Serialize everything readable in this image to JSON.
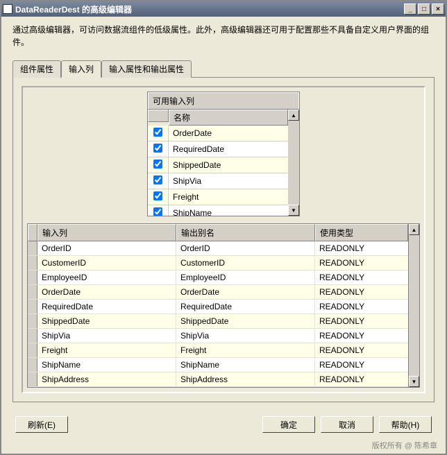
{
  "window": {
    "title": "DataReaderDest 的高级编辑器"
  },
  "description": "通过高级编辑器，可访问数据流组件的低级属性。此外，高级编辑器还可用于配置那些不具备自定义用户界面的组件。",
  "tabs": [
    {
      "label": "组件属性"
    },
    {
      "label": "输入列"
    },
    {
      "label": "输入属性和输出属性"
    }
  ],
  "activeTab": 1,
  "availableColumns": {
    "title": "可用输入列",
    "headerName": "名称",
    "rows": [
      {
        "name": "OrderDate",
        "checked": true
      },
      {
        "name": "RequiredDate",
        "checked": true
      },
      {
        "name": "ShippedDate",
        "checked": true
      },
      {
        "name": "ShipVia",
        "checked": true
      },
      {
        "name": "Freight",
        "checked": true
      },
      {
        "name": "ShipName",
        "checked": true
      }
    ]
  },
  "grid": {
    "headers": {
      "input": "输入列",
      "alias": "输出别名",
      "usage": "使用类型"
    },
    "rows": [
      {
        "input": "OrderID",
        "alias": "OrderID",
        "usage": "READONLY"
      },
      {
        "input": "CustomerID",
        "alias": "CustomerID",
        "usage": "READONLY"
      },
      {
        "input": "EmployeeID",
        "alias": "EmployeeID",
        "usage": "READONLY"
      },
      {
        "input": "OrderDate",
        "alias": "OrderDate",
        "usage": "READONLY"
      },
      {
        "input": "RequiredDate",
        "alias": "RequiredDate",
        "usage": "READONLY"
      },
      {
        "input": "ShippedDate",
        "alias": "ShippedDate",
        "usage": "READONLY"
      },
      {
        "input": "ShipVia",
        "alias": "ShipVia",
        "usage": "READONLY"
      },
      {
        "input": "Freight",
        "alias": "Freight",
        "usage": "READONLY"
      },
      {
        "input": "ShipName",
        "alias": "ShipName",
        "usage": "READONLY"
      },
      {
        "input": "ShipAddress",
        "alias": "ShipAddress",
        "usage": "READONLY"
      }
    ]
  },
  "buttons": {
    "refresh": "刷新(E)",
    "ok": "确定",
    "cancel": "取消",
    "help": "帮助(H)"
  },
  "watermark": "版权所有 @ 陈希章"
}
